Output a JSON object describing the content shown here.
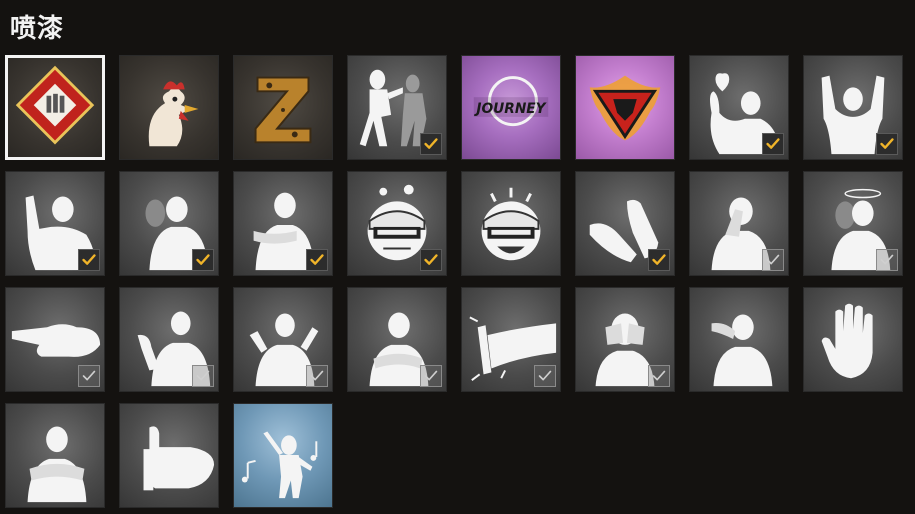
{
  "title": "喷漆",
  "colors": {
    "check_on": "#f0b429",
    "check_off": "#cfcfcf",
    "selected_border": "#f4f4f4"
  },
  "tiles": [
    {
      "icon": "red-diamond-emblem-icon",
      "bg": "dark",
      "check": "none",
      "selected": true
    },
    {
      "icon": "rooster-icon",
      "bg": "dark",
      "check": "none",
      "selected": false
    },
    {
      "icon": "letter-z-icon",
      "bg": "dark",
      "check": "none",
      "selected": false
    },
    {
      "icon": "two-fighters-icon",
      "bg": "gray",
      "check": "on",
      "selected": false
    },
    {
      "icon": "journey-logo-icon",
      "bg": "purple",
      "check": "none",
      "selected": false,
      "text": "JOURNEY"
    },
    {
      "icon": "red-wolf-emblem-icon",
      "bg": "pink",
      "check": "none",
      "selected": false
    },
    {
      "icon": "heart-hand-icon",
      "bg": "gray",
      "check": "on",
      "selected": false
    },
    {
      "icon": "hands-up-icon",
      "bg": "gray",
      "check": "on",
      "selected": false
    },
    {
      "icon": "wave-icon",
      "bg": "gray",
      "check": "on",
      "selected": false
    },
    {
      "icon": "look-back-icon",
      "bg": "gray",
      "check": "on",
      "selected": false
    },
    {
      "icon": "salute-icon",
      "bg": "gray",
      "check": "on",
      "selected": false
    },
    {
      "icon": "angry-helmet-icon",
      "bg": "gray",
      "check": "on",
      "selected": false
    },
    {
      "icon": "laughing-helmet-icon",
      "bg": "gray",
      "check": "none",
      "selected": false
    },
    {
      "icon": "clap-icon",
      "bg": "gray",
      "check": "on",
      "selected": false
    },
    {
      "icon": "facepalm-icon",
      "bg": "gray",
      "check": "off",
      "selected": false
    },
    {
      "icon": "dizzy-icon",
      "bg": "gray",
      "check": "off",
      "selected": false
    },
    {
      "icon": "point-icon",
      "bg": "gray",
      "check": "off",
      "selected": false
    },
    {
      "icon": "come-here-icon",
      "bg": "gray",
      "check": "off",
      "selected": false
    },
    {
      "icon": "cheer-icon",
      "bg": "gray",
      "check": "off",
      "selected": false
    },
    {
      "icon": "sleepy-icon",
      "bg": "gray",
      "check": "off",
      "selected": false
    },
    {
      "icon": "kick-icon",
      "bg": "gray",
      "check": "off",
      "selected": false
    },
    {
      "icon": "cover-face-icon",
      "bg": "gray",
      "check": "off",
      "selected": false
    },
    {
      "icon": "cry-icon",
      "bg": "gray",
      "check": "none",
      "selected": false
    },
    {
      "icon": "stop-hand-icon",
      "bg": "gray",
      "check": "none",
      "selected": false
    },
    {
      "icon": "arms-crossed-icon",
      "bg": "gray",
      "check": "none",
      "selected": false
    },
    {
      "icon": "thumbs-up-icon",
      "bg": "gray",
      "check": "none",
      "selected": false
    },
    {
      "icon": "dance-music-icon",
      "bg": "blue",
      "check": "none",
      "selected": false
    }
  ]
}
